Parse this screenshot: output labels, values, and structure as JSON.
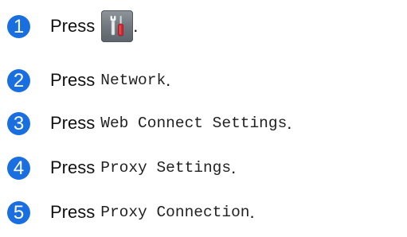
{
  "steps": [
    {
      "number": "1",
      "press": "Press",
      "target": "",
      "end": ".",
      "icon": "settings-tools-icon"
    },
    {
      "number": "2",
      "press": "Press",
      "target": "Network",
      "end": "."
    },
    {
      "number": "3",
      "press": "Press",
      "target": "Web Connect Settings",
      "end": "."
    },
    {
      "number": "4",
      "press": "Press",
      "target": "Proxy Settings",
      "end": "."
    },
    {
      "number": "5",
      "press": "Press",
      "target": "Proxy Connection",
      "end": "."
    }
  ],
  "colors": {
    "step_circle": "#1a6fe0",
    "text": "#111111",
    "button": "#6f767d"
  }
}
